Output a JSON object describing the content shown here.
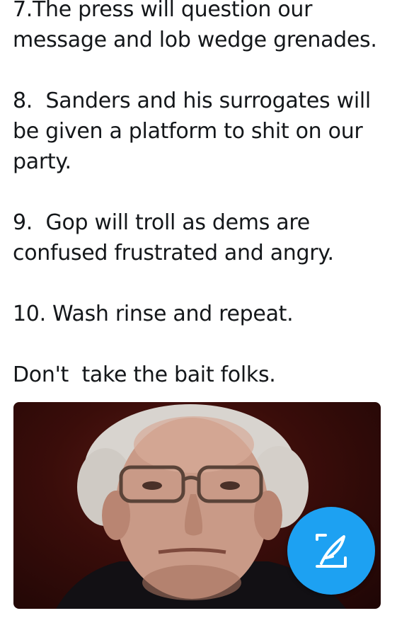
{
  "tweet": {
    "lines": [
      "7.The press will question our",
      "message and lob wedge grenades.",
      "",
      "8.  Sanders and his surrogates will",
      "be given a platform to shit on our",
      "party.",
      "",
      "9.  Gop will troll as dems are",
      "confused frustrated and angry.",
      "",
      "10. Wash rinse and repeat.",
      "",
      "Don't  take the bait folks."
    ]
  },
  "media": {
    "icon": "photo-of-man-with-glasses"
  },
  "compose_button": {
    "icon": "compose-tweet-icon",
    "color": "#1da1f2"
  }
}
